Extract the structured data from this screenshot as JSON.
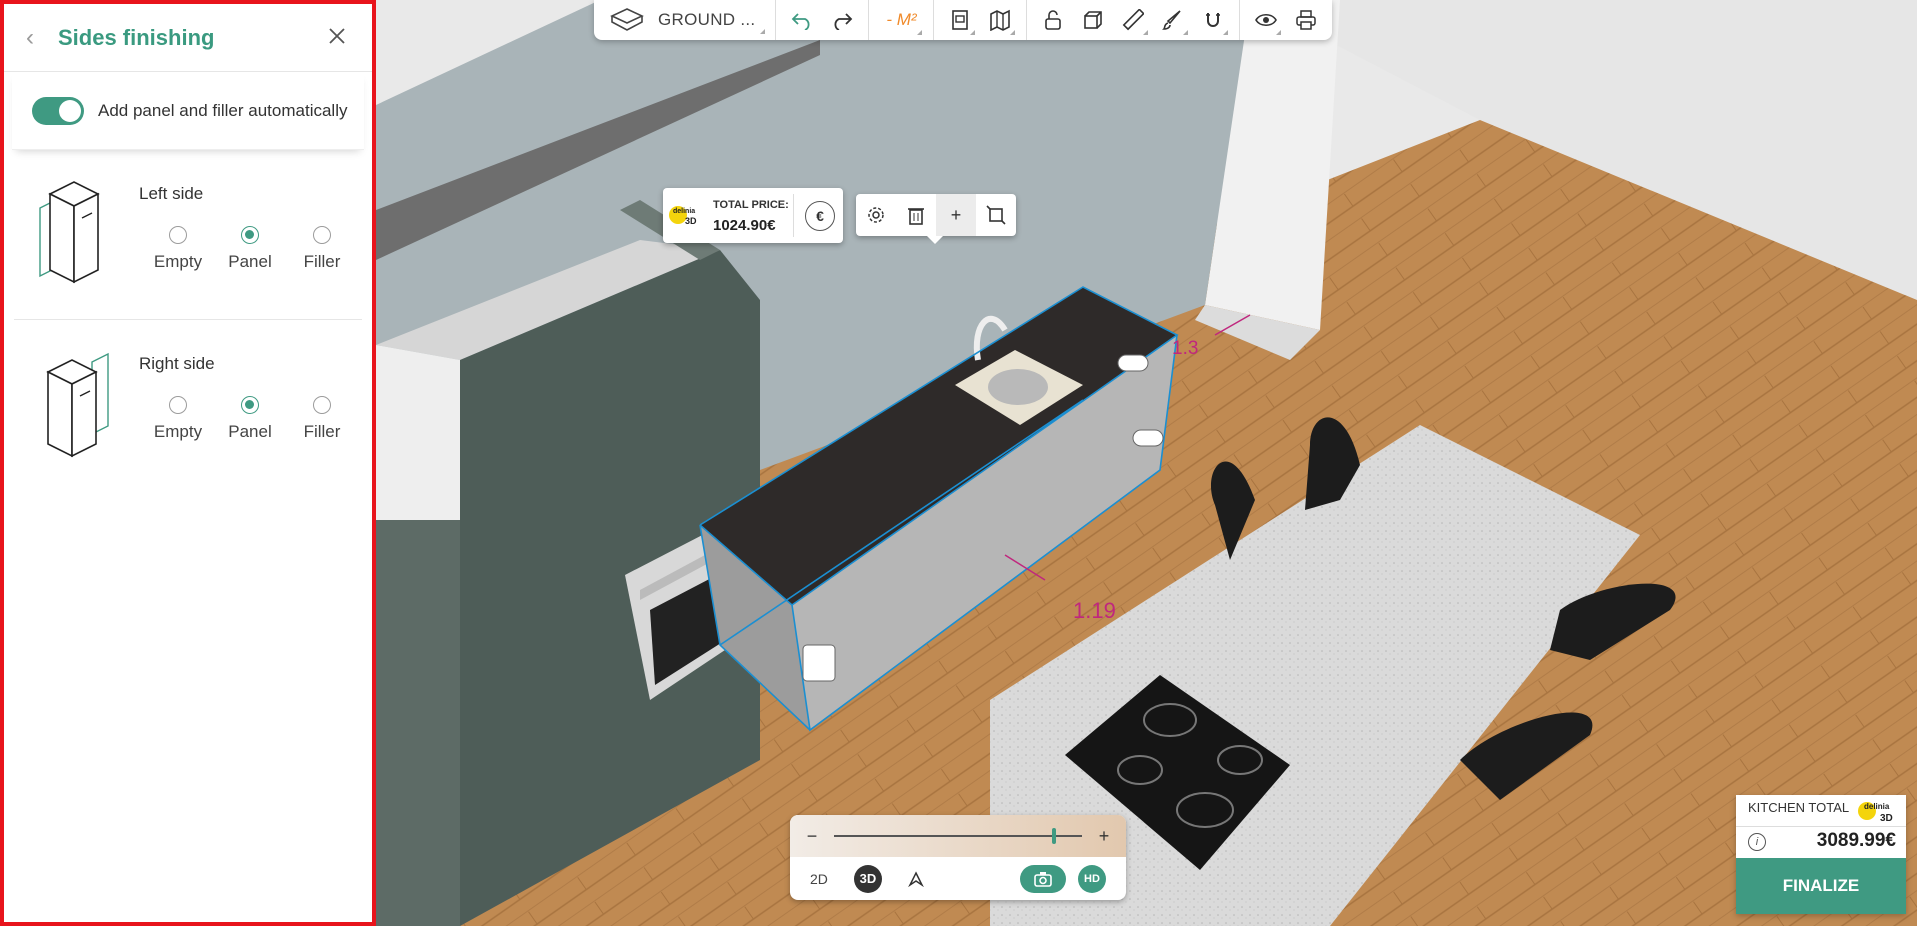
{
  "panel": {
    "title": "Sides finishing",
    "auto_label": "Add panel and filler automatically",
    "auto_enabled": true,
    "left_side": {
      "title": "Left side",
      "options": [
        "Empty",
        "Panel",
        "Filler"
      ],
      "selected": "Panel"
    },
    "right_side": {
      "title": "Right side",
      "options": [
        "Empty",
        "Panel",
        "Filler"
      ],
      "selected": "Panel"
    }
  },
  "toolbar": {
    "floor_label": "GROUND ...",
    "m2_label": "- M²",
    "icons": [
      "floor-icon",
      "undo-icon",
      "redo-icon",
      "document-icon",
      "map-icon",
      "unlock-icon",
      "cube-icon",
      "ruler-icon",
      "paint-brush-icon",
      "magnet-icon",
      "eye-icon",
      "print-icon"
    ]
  },
  "price_popup": {
    "label": "TOTAL PRICE:",
    "value": "1024.90€",
    "currency_symbol": "€"
  },
  "context_toolbar": {
    "icons": [
      "settings-icon",
      "trash-icon",
      "plus-icon",
      "resize-icon"
    ],
    "plus_label": "+"
  },
  "scene": {
    "dimension_a": "1.19",
    "dimension_b": "1.3",
    "colors": {
      "wall": "#a9b4b8",
      "floor": "#c08a52",
      "cabinet": "#4e5d58",
      "counter": "#2e2a29",
      "selection": "#1b8fd2",
      "dimension": "#c0277e"
    }
  },
  "zoom": {
    "minus": "−",
    "plus": "+",
    "level": 0.88
  },
  "view_modes": {
    "mode_2d": "2D",
    "mode_3d": "3D",
    "hd": "HD"
  },
  "total": {
    "label": "KITCHEN TOTAL",
    "value": "3089.99€",
    "finalize": "FINALIZE",
    "info": "i"
  },
  "brand": {
    "logo_text_top": "delinia",
    "logo_text_bottom": "3D",
    "accent": "#3f9a82",
    "logo_yellow": "#f4d40c"
  }
}
